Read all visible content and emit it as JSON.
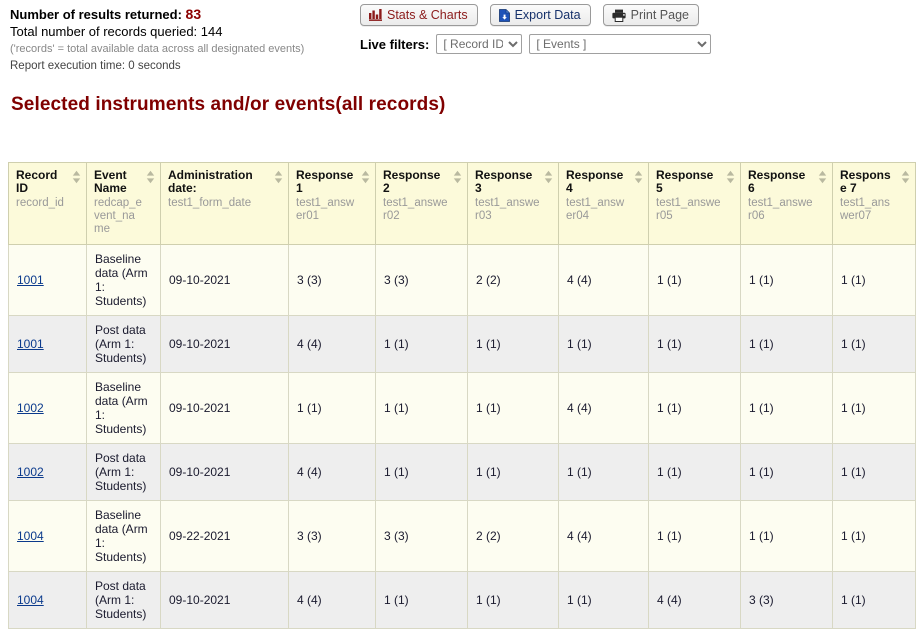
{
  "summary": {
    "results_label": "Number of results returned:",
    "results_count": "83",
    "queried_line": "Total number of records queried:  144",
    "records_note": "('records' = total available data across all designated events)",
    "exec_time": "Report execution time: 0 seconds"
  },
  "toolbar": {
    "stats_label": "Stats & Charts",
    "export_label": "Export Data",
    "print_label": "Print Page",
    "stats_color": "#8b1a1a",
    "export_color": "#16316b",
    "print_color": "#555555"
  },
  "filters": {
    "label": "Live filters:",
    "record_selected": "[ Record ID ]",
    "events_selected": "[ Events ]"
  },
  "heading": "Selected instruments and/or events(all records)",
  "table": {
    "columns": [
      {
        "label": "Record ID",
        "var": "record_id"
      },
      {
        "label": "Event Name",
        "var": "redcap_event_name"
      },
      {
        "label": "Administration date:",
        "var": "test1_form_date"
      },
      {
        "label": "Response 1",
        "var": "test1_answer01"
      },
      {
        "label": "Response 2",
        "var": "test1_answer02"
      },
      {
        "label": "Response 3",
        "var": "test1_answer03"
      },
      {
        "label": "Response 4",
        "var": "test1_answer04"
      },
      {
        "label": "Response 5",
        "var": "test1_answer05"
      },
      {
        "label": "Response 6",
        "var": "test1_answer06"
      },
      {
        "label": "Response 7",
        "var": "test1_answer07"
      }
    ],
    "rows": [
      {
        "record_id": "1001",
        "event_name": "Baseline data (Arm 1: Students)",
        "date": "09-10-2021",
        "answers": [
          "3 (3)",
          "3 (3)",
          "2 (2)",
          "4 (4)",
          "1 (1)",
          "1 (1)",
          "1 (1)"
        ]
      },
      {
        "record_id": "1001",
        "event_name": "Post data (Arm 1: Students)",
        "date": "09-10-2021",
        "answers": [
          "4 (4)",
          "1 (1)",
          "1 (1)",
          "1 (1)",
          "1 (1)",
          "1 (1)",
          "1 (1)"
        ]
      },
      {
        "record_id": "1002",
        "event_name": "Baseline data (Arm 1: Students)",
        "date": "09-10-2021",
        "answers": [
          "1 (1)",
          "1 (1)",
          "1 (1)",
          "4 (4)",
          "1 (1)",
          "1 (1)",
          "1 (1)"
        ]
      },
      {
        "record_id": "1002",
        "event_name": "Post data (Arm 1: Students)",
        "date": "09-10-2021",
        "answers": [
          "4 (4)",
          "1 (1)",
          "1 (1)",
          "1 (1)",
          "1 (1)",
          "1 (1)",
          "1 (1)"
        ]
      },
      {
        "record_id": "1004",
        "event_name": "Baseline data (Arm 1: Students)",
        "date": "09-22-2021",
        "answers": [
          "3 (3)",
          "3 (3)",
          "2 (2)",
          "4 (4)",
          "1 (1)",
          "1 (1)",
          "1 (1)"
        ]
      },
      {
        "record_id": "1004",
        "event_name": "Post data (Arm 1: Students)",
        "date": "09-10-2021",
        "answers": [
          "4 (4)",
          "1 (1)",
          "1 (1)",
          "1 (1)",
          "4 (4)",
          "3 (3)",
          "1 (1)"
        ]
      }
    ]
  },
  "icons": {
    "stats": "bar-chart-icon",
    "export": "file-download-icon",
    "print": "printer-icon",
    "sort": "sort-updown-icon"
  }
}
